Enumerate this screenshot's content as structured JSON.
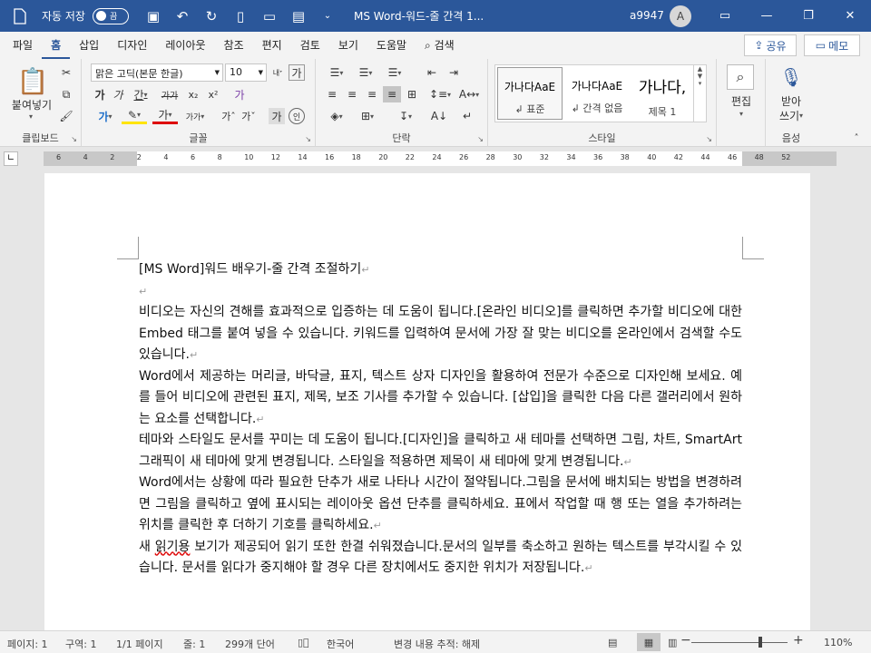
{
  "titlebar": {
    "autosave_label": "자동 저장",
    "autosave_state": "끔",
    "doc_title": "MS Word-워드-줄 간격 1...",
    "user_name": "a9947",
    "avatar_initial": "A"
  },
  "tabs": [
    "파일",
    "홈",
    "삽입",
    "디자인",
    "레이아웃",
    "참조",
    "편지",
    "검토",
    "보기",
    "도움말",
    "검색"
  ],
  "share_label": "공유",
  "memo_label": "메모",
  "ribbon": {
    "clipboard": {
      "paste_label": "붙여넣기",
      "group_label": "클립보드"
    },
    "font": {
      "font_name": "맑은 고딕(본문 한글)",
      "font_size": "10",
      "group_label": "글꼴"
    },
    "paragraph": {
      "group_label": "단락"
    },
    "styles": {
      "group_label": "스타일",
      "items": [
        {
          "preview": "가나다AaE",
          "name": "↲ 표준"
        },
        {
          "preview": "가나다AaE",
          "name": "↲ 간격 없음"
        },
        {
          "preview": "가나다,",
          "name": "제목 1"
        }
      ]
    },
    "editing": {
      "label": "편집"
    },
    "voice": {
      "label_line1": "받아",
      "label_line2": "쓰기",
      "group_label": "음성"
    }
  },
  "ruler": {
    "ticks": [
      "6",
      "4",
      "2",
      "2",
      "4",
      "6",
      "8",
      "10",
      "12",
      "14",
      "16",
      "18",
      "20",
      "22",
      "24",
      "26",
      "28",
      "30",
      "32",
      "34",
      "36",
      "38",
      "40",
      "42",
      "44",
      "46",
      "48",
      "52"
    ]
  },
  "vruler": {
    "ticks": [
      "1",
      "2",
      "1",
      "2",
      "4",
      "6",
      "8",
      "10",
      "12",
      "14",
      "16",
      "18",
      "20",
      "22"
    ]
  },
  "document": {
    "title_line": "[MS Word]워드 배우기-줄 간격 조절하기",
    "paragraphs": [
      "비디오는 자신의 견해를 효과적으로 입증하는 데 도움이 됩니다.[온라인 비디오]를 클릭하면 추가할 비디오에 대한 Embed 태그를 붙여 넣을 수 있습니다. 키워드를 입력하여 문서에 가장 잘 맞는 비디오를 온라인에서 검색할 수도 있습니다.",
      "Word에서 제공하는 머리글, 바닥글, 표지, 텍스트 상자 디자인을 활용하여 전문가 수준으로 디자인해 보세요. 예를 들어 비디오에 관련된 표지, 제목, 보조 기사를 추가할 수 있습니다. [삽입]을 클릭한 다음 다른 갤러리에서 원하는 요소를 선택합니다.",
      "테마와 스타일도 문서를 꾸미는 데 도움이 됩니다.[디자인]을 클릭하고 새 테마를 선택하면 그림, 차트, SmartArt 그래픽이 새 테마에 맞게 변경됩니다. 스타일을 적용하면 제목이 새 테마에 맞게 변경됩니다.",
      "Word에서는 상황에 따라 필요한 단추가 새로 나타나 시간이 절약됩니다.그림을 문서에 배치되는 방법을 변경하려면 그림을 클릭하고 옆에 표시되는 레이아웃 옵션 단추를 클릭하세요. 표에서 작업할 때 행 또는 열을 추가하려는 위치를 클릭한 후 더하기 기호를 클릭하세요."
    ],
    "last_para_before": "새 ",
    "last_para_squiggle": "읽기용",
    "last_para_after": " 보기가 제공되어 읽기 또한 한결 쉬워졌습니다.문서의 일부를 축소하고 원하는 텍스트를 부각시킬 수 있습니다. 문서를 읽다가 중지해야 할 경우 다른 장치에서도 중지한 위치가 저장됩니다."
  },
  "statusbar": {
    "page": "페이지: 1",
    "section": "구역: 1",
    "page_of": "1/1 페이지",
    "line": "줄: 1",
    "words": "299개 단어",
    "language": "한국어",
    "track_changes": "변경 내용 추적: 해제",
    "zoom": "110%"
  },
  "colors": {
    "titlebar": "#2b579a",
    "accent": "#2b579a",
    "ribbon": "#f3f3f3"
  }
}
